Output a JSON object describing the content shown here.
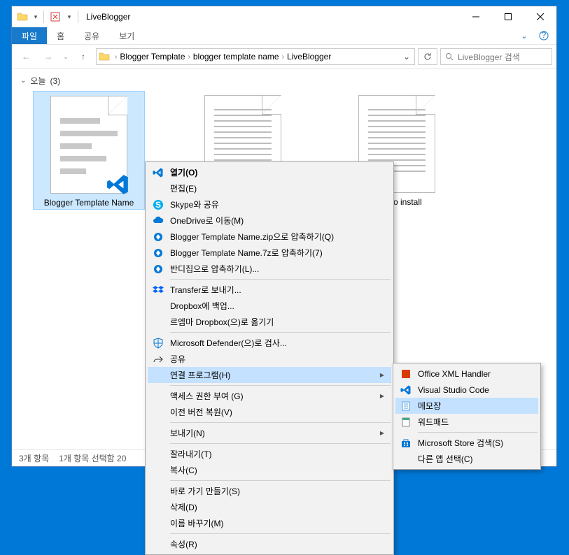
{
  "titlebar": {
    "title": "LiveBlogger"
  },
  "ribbon": {
    "file": "파일",
    "home": "홈",
    "share": "공유",
    "view": "보기"
  },
  "nav": {
    "crumbs": [
      "Blogger Template",
      "blogger template name",
      "LiveBlogger"
    ],
    "search_placeholder": "LiveBlogger 검색"
  },
  "group": {
    "label": "오늘",
    "count": "(3)"
  },
  "items": [
    {
      "label": "Blogger Template Name"
    },
    {
      "label": ""
    },
    {
      "label": "How to install"
    }
  ],
  "status": {
    "count": "3개 항목",
    "selection": "1개 항목 선택함 20"
  },
  "context_menu": [
    {
      "label": "열기(O)",
      "icon": "vscode",
      "bold": true
    },
    {
      "label": "편집(E)"
    },
    {
      "label": "Skype와 공유",
      "icon": "skype"
    },
    {
      "label": "OneDrive로 이동(M)",
      "icon": "cloud"
    },
    {
      "label": "Blogger Template Name.zip으로 압축하기(Q)",
      "icon": "bandi"
    },
    {
      "label": "Blogger Template Name.7z로 압축하기(7)",
      "icon": "bandi"
    },
    {
      "label": "반디집으로 압축하기(L)...",
      "icon": "bandi"
    },
    {
      "sep": true
    },
    {
      "label": "Transfer로 보내기...",
      "icon": "dropbox"
    },
    {
      "label": "Dropbox에 백업..."
    },
    {
      "label": "르엠마 Dropbox(으)로 옮기기"
    },
    {
      "sep": true
    },
    {
      "label": "Microsoft Defender(으)로 검사...",
      "icon": "defender"
    },
    {
      "label": "공유",
      "icon": "share"
    },
    {
      "label": "연결 프로그램(H)",
      "arrow": true,
      "hover": true
    },
    {
      "sep": true
    },
    {
      "label": "액세스 권한 부여 (G)",
      "arrow": true
    },
    {
      "label": "이전 버전 복원(V)"
    },
    {
      "sep": true
    },
    {
      "label": "보내기(N)",
      "arrow": true
    },
    {
      "sep": true
    },
    {
      "label": "잘라내기(T)"
    },
    {
      "label": "복사(C)"
    },
    {
      "sep": true
    },
    {
      "label": "바로 가기 만들기(S)"
    },
    {
      "label": "삭제(D)"
    },
    {
      "label": "이름 바꾸기(M)"
    },
    {
      "sep": true
    },
    {
      "label": "속성(R)"
    }
  ],
  "submenu": [
    {
      "label": "Office XML Handler",
      "icon": "office"
    },
    {
      "label": "Visual Studio Code",
      "icon": "vscode"
    },
    {
      "label": "메모장",
      "icon": "notepad",
      "hover": true
    },
    {
      "label": "워드패드",
      "icon": "wordpad"
    },
    {
      "sep": true
    },
    {
      "label": "Microsoft Store 검색(S)",
      "icon": "store"
    },
    {
      "label": "다른 앱 선택(C)"
    }
  ]
}
